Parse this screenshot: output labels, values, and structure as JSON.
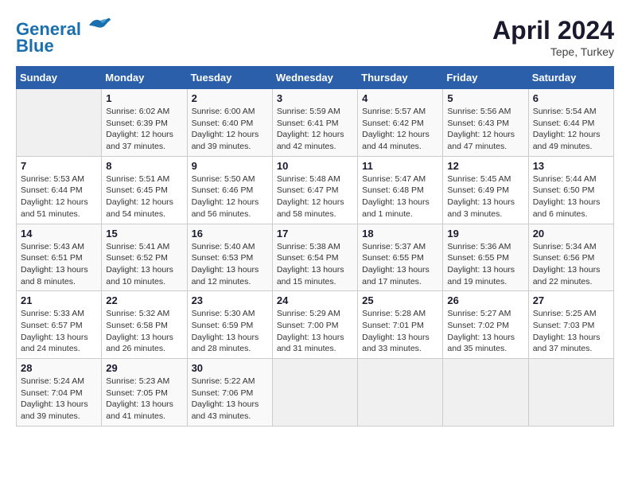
{
  "header": {
    "logo_line1": "General",
    "logo_line2": "Blue",
    "month_title": "April 2024",
    "subtitle": "Tepe, Turkey"
  },
  "calendar": {
    "days_of_week": [
      "Sunday",
      "Monday",
      "Tuesday",
      "Wednesday",
      "Thursday",
      "Friday",
      "Saturday"
    ],
    "weeks": [
      [
        {
          "num": "",
          "info": ""
        },
        {
          "num": "1",
          "info": "Sunrise: 6:02 AM\nSunset: 6:39 PM\nDaylight: 12 hours\nand 37 minutes."
        },
        {
          "num": "2",
          "info": "Sunrise: 6:00 AM\nSunset: 6:40 PM\nDaylight: 12 hours\nand 39 minutes."
        },
        {
          "num": "3",
          "info": "Sunrise: 5:59 AM\nSunset: 6:41 PM\nDaylight: 12 hours\nand 42 minutes."
        },
        {
          "num": "4",
          "info": "Sunrise: 5:57 AM\nSunset: 6:42 PM\nDaylight: 12 hours\nand 44 minutes."
        },
        {
          "num": "5",
          "info": "Sunrise: 5:56 AM\nSunset: 6:43 PM\nDaylight: 12 hours\nand 47 minutes."
        },
        {
          "num": "6",
          "info": "Sunrise: 5:54 AM\nSunset: 6:44 PM\nDaylight: 12 hours\nand 49 minutes."
        }
      ],
      [
        {
          "num": "7",
          "info": "Sunrise: 5:53 AM\nSunset: 6:44 PM\nDaylight: 12 hours\nand 51 minutes."
        },
        {
          "num": "8",
          "info": "Sunrise: 5:51 AM\nSunset: 6:45 PM\nDaylight: 12 hours\nand 54 minutes."
        },
        {
          "num": "9",
          "info": "Sunrise: 5:50 AM\nSunset: 6:46 PM\nDaylight: 12 hours\nand 56 minutes."
        },
        {
          "num": "10",
          "info": "Sunrise: 5:48 AM\nSunset: 6:47 PM\nDaylight: 12 hours\nand 58 minutes."
        },
        {
          "num": "11",
          "info": "Sunrise: 5:47 AM\nSunset: 6:48 PM\nDaylight: 13 hours\nand 1 minute."
        },
        {
          "num": "12",
          "info": "Sunrise: 5:45 AM\nSunset: 6:49 PM\nDaylight: 13 hours\nand 3 minutes."
        },
        {
          "num": "13",
          "info": "Sunrise: 5:44 AM\nSunset: 6:50 PM\nDaylight: 13 hours\nand 6 minutes."
        }
      ],
      [
        {
          "num": "14",
          "info": "Sunrise: 5:43 AM\nSunset: 6:51 PM\nDaylight: 13 hours\nand 8 minutes."
        },
        {
          "num": "15",
          "info": "Sunrise: 5:41 AM\nSunset: 6:52 PM\nDaylight: 13 hours\nand 10 minutes."
        },
        {
          "num": "16",
          "info": "Sunrise: 5:40 AM\nSunset: 6:53 PM\nDaylight: 13 hours\nand 12 minutes."
        },
        {
          "num": "17",
          "info": "Sunrise: 5:38 AM\nSunset: 6:54 PM\nDaylight: 13 hours\nand 15 minutes."
        },
        {
          "num": "18",
          "info": "Sunrise: 5:37 AM\nSunset: 6:55 PM\nDaylight: 13 hours\nand 17 minutes."
        },
        {
          "num": "19",
          "info": "Sunrise: 5:36 AM\nSunset: 6:55 PM\nDaylight: 13 hours\nand 19 minutes."
        },
        {
          "num": "20",
          "info": "Sunrise: 5:34 AM\nSunset: 6:56 PM\nDaylight: 13 hours\nand 22 minutes."
        }
      ],
      [
        {
          "num": "21",
          "info": "Sunrise: 5:33 AM\nSunset: 6:57 PM\nDaylight: 13 hours\nand 24 minutes."
        },
        {
          "num": "22",
          "info": "Sunrise: 5:32 AM\nSunset: 6:58 PM\nDaylight: 13 hours\nand 26 minutes."
        },
        {
          "num": "23",
          "info": "Sunrise: 5:30 AM\nSunset: 6:59 PM\nDaylight: 13 hours\nand 28 minutes."
        },
        {
          "num": "24",
          "info": "Sunrise: 5:29 AM\nSunset: 7:00 PM\nDaylight: 13 hours\nand 31 minutes."
        },
        {
          "num": "25",
          "info": "Sunrise: 5:28 AM\nSunset: 7:01 PM\nDaylight: 13 hours\nand 33 minutes."
        },
        {
          "num": "26",
          "info": "Sunrise: 5:27 AM\nSunset: 7:02 PM\nDaylight: 13 hours\nand 35 minutes."
        },
        {
          "num": "27",
          "info": "Sunrise: 5:25 AM\nSunset: 7:03 PM\nDaylight: 13 hours\nand 37 minutes."
        }
      ],
      [
        {
          "num": "28",
          "info": "Sunrise: 5:24 AM\nSunset: 7:04 PM\nDaylight: 13 hours\nand 39 minutes."
        },
        {
          "num": "29",
          "info": "Sunrise: 5:23 AM\nSunset: 7:05 PM\nDaylight: 13 hours\nand 41 minutes."
        },
        {
          "num": "30",
          "info": "Sunrise: 5:22 AM\nSunset: 7:06 PM\nDaylight: 13 hours\nand 43 minutes."
        },
        {
          "num": "",
          "info": ""
        },
        {
          "num": "",
          "info": ""
        },
        {
          "num": "",
          "info": ""
        },
        {
          "num": "",
          "info": ""
        }
      ]
    ]
  }
}
